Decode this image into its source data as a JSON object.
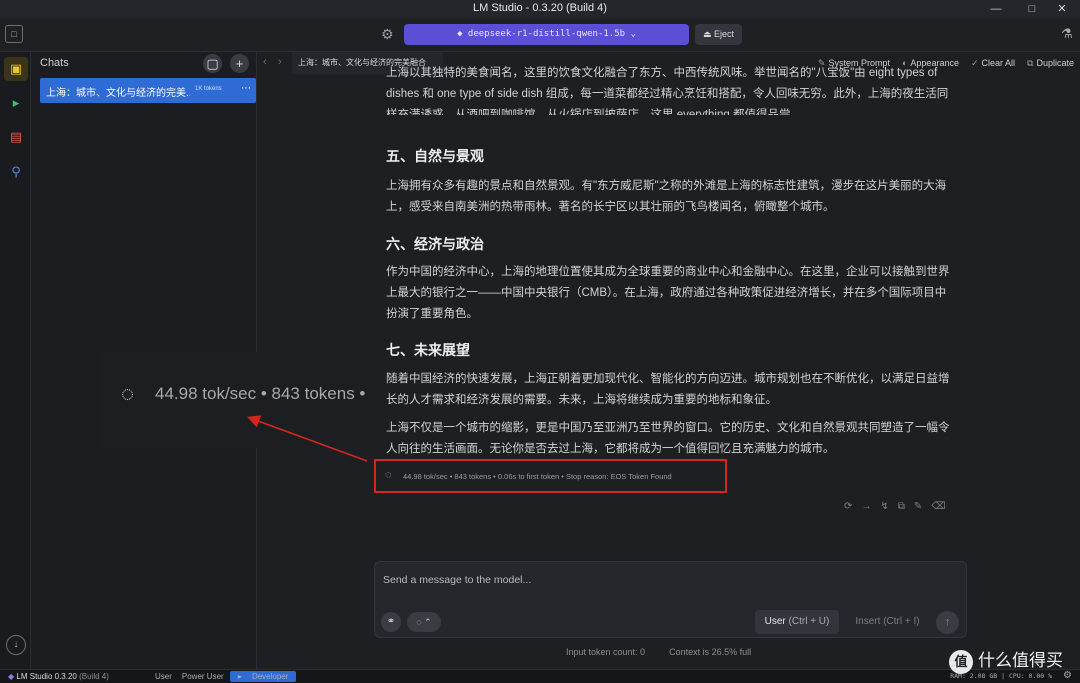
{
  "window": {
    "title": "LM Studio - 0.3.20 (Build 4)"
  },
  "toolbar": {
    "model_label": "deepseek-r1-distill-qwen-1.5b",
    "eject_label": "Eject"
  },
  "chats_panel": {
    "title": "Chats",
    "items": [
      {
        "label": "上海：城市、文化与经济的完美...",
        "tokens": "1K tokens"
      }
    ]
  },
  "chat_header": {
    "tab_label": "上海：城市、文化与经济的完美融合",
    "actions": [
      "System Prompt",
      "Appearance",
      "Clear All",
      "Duplicate"
    ]
  },
  "content": {
    "para_top": "上海以其独特的美食闻名，这里的饮食文化融合了东方、中西传统风味。举世闻名的\"八宝饭\"由 eight types of dishes 和 one type of side dish 组成，每一道菜都经过精心烹饪和搭配，令人回味无穷。此外，上海的夜生活同样充满诱惑，从酒吧到咖啡馆，从火锅店到披萨店，这里 everything 都值得品尝。",
    "h5": "五、自然与景观",
    "p5": "上海拥有众多有趣的景点和自然景观。有\"东方威尼斯\"之称的外滩是上海的标志性建筑，漫步在这片美丽的大海上，感受来自南美洲的热带雨林。著名的长宁区以其壮丽的飞鸟楼闻名，俯瞰整个城市。",
    "h6": "六、经济与政治",
    "p6": "作为中国的经济中心，上海的地理位置使其成为全球重要的商业中心和金融中心。在这里，企业可以接触到世界上最大的银行之一——中国中央银行（CMB）。在上海，政府通过各种政策促进经济增长，并在多个国际项目中扮演了重要角色。",
    "h7": "七、未来展望",
    "p7": "随着中国经济的快速发展，上海正朝着更加现代化、智能化的方向迈进。城市规划也在不断优化，以满足日益增长的人才需求和经济发展的需要。未来，上海将继续成为重要的地标和象征。",
    "p8": "上海不仅是一个城市的缩影，更是中国乃至亚洲乃至世界的窗口。它的历史、文化和自然景观共同塑造了一幅令人向往的生活画面。无论你是否去过上海，它都将成为一个值得回忆且充满魅力的城市。"
  },
  "stats": {
    "text": "44.98 tok/sec • 843 tokens • 0.06s to first token • Stop reason: EOS Token Found",
    "zoom_text": "44.98 tok/sec • 843 tokens •"
  },
  "input": {
    "placeholder": "Send a message to the model...",
    "user_label": "User",
    "user_shortcut": "(Ctrl + U)",
    "insert_label": "Insert (Ctrl + I)"
  },
  "footer": {
    "input_tokens": "Input token count:  0",
    "context": "Context is 26.5% full"
  },
  "statusbar": {
    "app_label": "LM Studio 0.3.20",
    "build": "(Build 4)",
    "modes": [
      "User",
      "Power User",
      "Developer"
    ],
    "active_mode": "Developer",
    "ram": "RAM: 2.08 GB",
    "cpu": "CPU: 0.00 %"
  },
  "watermark": {
    "text": "什么值得买"
  },
  "colors": {
    "accent": "#5b4fd6",
    "selection": "#2f6bd4",
    "highlight_box": "#d3261d",
    "active_rail": "#e8c53d"
  },
  "icons": [
    "chat-icon",
    "terminal-icon",
    "folder-icon",
    "search-icon",
    "download-icon",
    "gear-icon",
    "flask-icon",
    "bulb-icon",
    "paperclip-icon",
    "plus-icon",
    "folder-plus-icon"
  ]
}
